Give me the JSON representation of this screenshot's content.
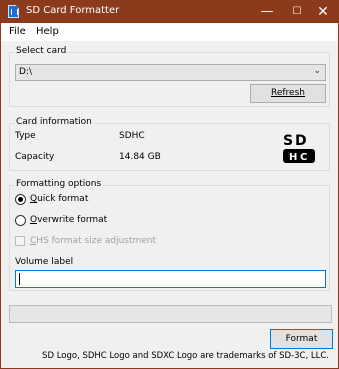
{
  "window": {
    "title": "SD Card Formatter",
    "colors": {
      "titlebar": "#8b3a1c",
      "accent": "#0078d7"
    },
    "controls": {
      "minimize_icon": "minimize-icon",
      "maximize_icon": "maximize-icon",
      "close_icon": "close-icon"
    }
  },
  "menu": {
    "file": "File",
    "help": "Help"
  },
  "select_card": {
    "group_label": "Select card",
    "selected_drive": "D:\\",
    "refresh_label": "Refresh"
  },
  "card_info": {
    "group_label": "Card information",
    "type_label": "Type",
    "type_value": "SDHC",
    "capacity_label": "Capacity",
    "capacity_value": "14.84 GB",
    "logo_icon": "sdhc-logo-icon"
  },
  "formatting": {
    "group_label": "Formatting options",
    "quick_format": "Quick format",
    "overwrite_format": "Overwrite format",
    "chs_label": "CHS format size adjustment",
    "selected_option": "Quick format",
    "volume_label_title": "Volume label",
    "volume_label_value": ""
  },
  "progress": {
    "value": 0
  },
  "format_button": "Format",
  "footer": "SD Logo, SDHC Logo and SDXC Logo are trademarks of SD-3C, LLC."
}
